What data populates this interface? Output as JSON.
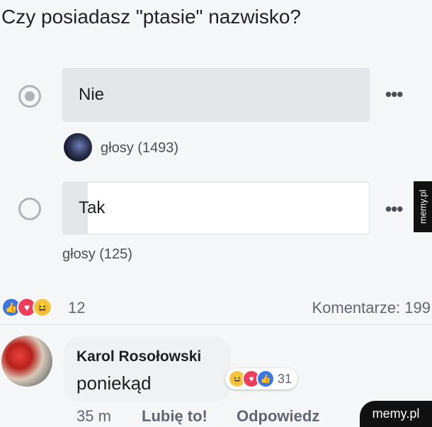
{
  "poll": {
    "question": "Czy posiadasz \"ptasie\" nazwisko?",
    "options": [
      {
        "label": "Nie",
        "selected": true,
        "votes_text": "głosy (1493)",
        "fill": 1.0
      },
      {
        "label": "Tak",
        "selected": false,
        "votes_text": "głosy (125)",
        "fill": 0.08
      }
    ],
    "more_label": "•••"
  },
  "reactions": {
    "count": "12",
    "comments_label": "Komentarze: 199"
  },
  "comment": {
    "author": "Karol Rosołowski",
    "text": "poniekąd",
    "reaction_count": "31",
    "time": "35 m",
    "like_label": "Lubię to!",
    "reply_label": "Odpowiedz"
  },
  "watermark": {
    "side": "memy.pl",
    "corner": "memy.pl"
  },
  "colors": {
    "like": "#3b78e7",
    "love": "#ef3e5c",
    "haha": "#f7c441"
  }
}
